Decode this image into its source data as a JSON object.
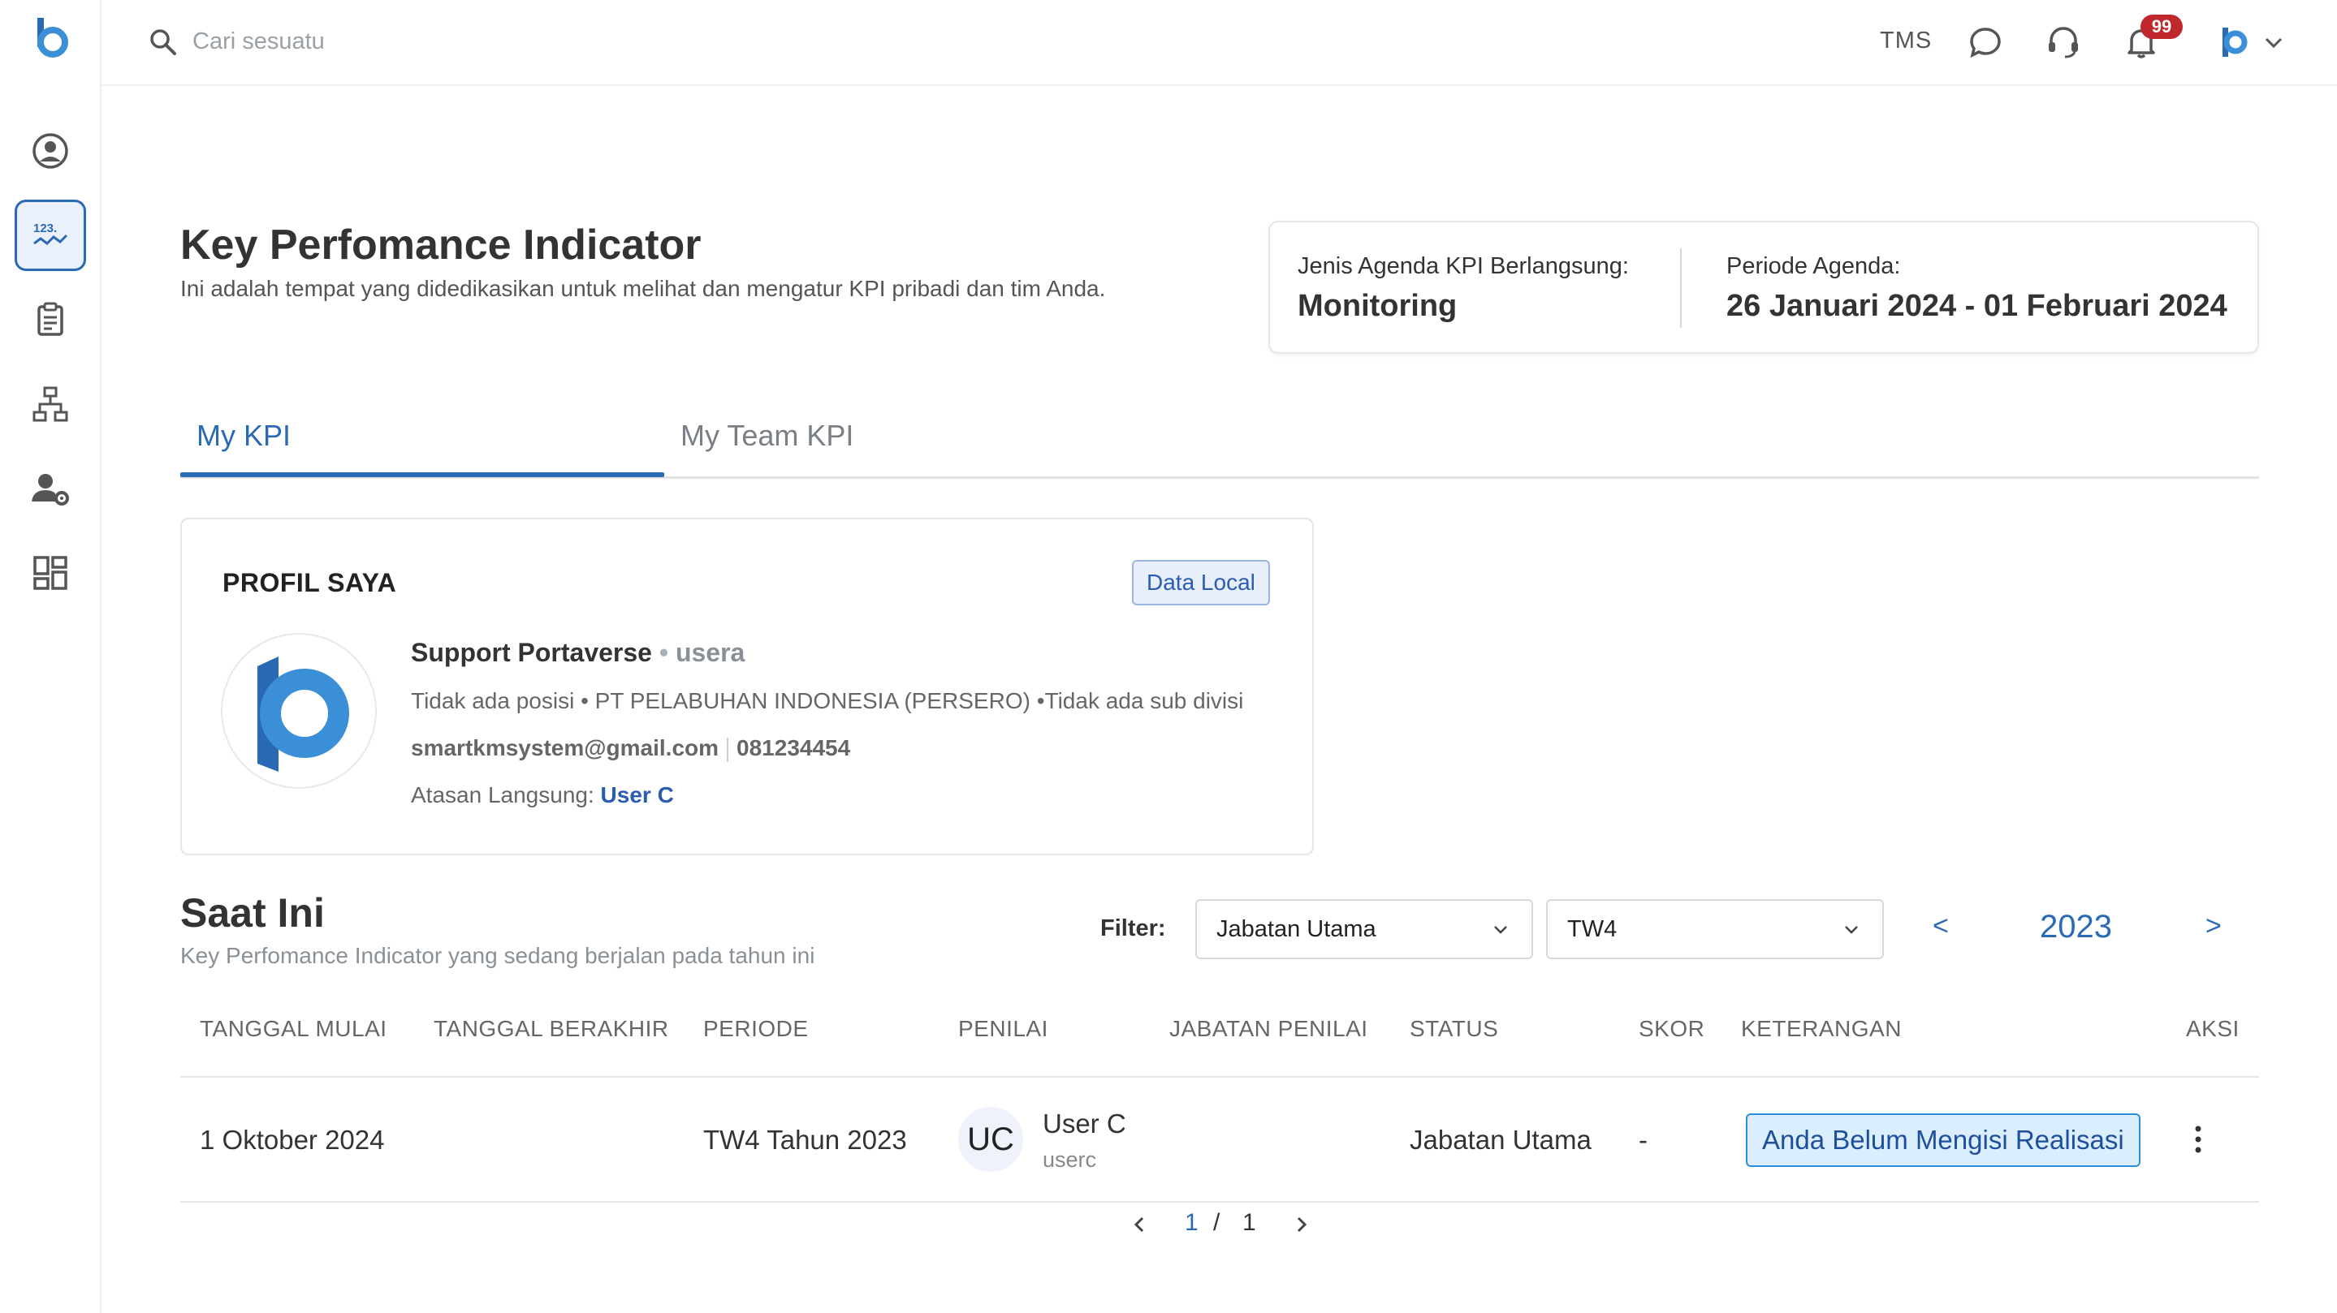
{
  "header": {
    "search_placeholder": "Cari sesuatu",
    "tms_label": "TMS",
    "notification_count": "99"
  },
  "sidebar": {
    "items": [
      {
        "name": "profile",
        "icon": "user-circle-icon"
      },
      {
        "name": "kpi",
        "icon": "kpi-chart-icon",
        "active": true
      },
      {
        "name": "clipboard",
        "icon": "clipboard-icon"
      },
      {
        "name": "org-chart",
        "icon": "org-chart-icon"
      },
      {
        "name": "user-settings",
        "icon": "user-gear-icon"
      },
      {
        "name": "dashboard",
        "icon": "dashboard-icon"
      }
    ],
    "kpi_icon_text": "123."
  },
  "page": {
    "title": "Key Perfomance Indicator",
    "subtitle": "Ini adalah tempat yang didedikasikan untuk melihat dan mengatur KPI pribadi dan tim Anda."
  },
  "agenda": {
    "type_label": "Jenis Agenda KPI Berlangsung:",
    "type_value": "Monitoring",
    "period_label": "Periode Agenda:",
    "period_value": "26 Januari 2024 - 01 Februari 2024"
  },
  "tabs": [
    {
      "label": "My KPI",
      "active": true
    },
    {
      "label": "My Team KPI",
      "active": false
    }
  ],
  "profile": {
    "section_title": "PROFIL SAYA",
    "badge": "Data Local",
    "name": "Support Portaverse",
    "dot": "•",
    "username": "usera",
    "position_line": "Tidak ada posisi • PT PELABUHAN INDONESIA (PERSERO) •Tidak ada sub divisi",
    "email": "smartkmsystem@gmail.com",
    "phone": "081234454",
    "supervisor_label": "Atasan Langsung:",
    "supervisor_name": "User C"
  },
  "current": {
    "title": "Saat Ini",
    "subtitle": "Key Perfomance Indicator yang sedang berjalan pada tahun ini",
    "filter_label": "Filter:",
    "filter_position": "Jabatan Utama",
    "filter_period": "TW4",
    "prev": "<",
    "next": ">",
    "year": "2023"
  },
  "table": {
    "headers": {
      "start": "TANGGAL MULAI",
      "end": "TANGGAL BERAKHIR",
      "period": "PERIODE",
      "reviewer": "PENILAI",
      "reviewer_position": "JABATAN PENILAI",
      "status": "STATUS",
      "score": "SKOR",
      "note": "KETERANGAN",
      "action": "AKSI"
    },
    "rows": [
      {
        "start": "1 Oktober 2024",
        "end": "",
        "period": "TW4 Tahun 2023",
        "reviewer_initials": "UC",
        "reviewer_name": "User C",
        "reviewer_username": "userc",
        "reviewer_position": "",
        "status": "Jabatan Utama",
        "score": "-",
        "note": "Anda Belum Mengisi Realisasi"
      }
    ]
  },
  "pagination": {
    "current": "1",
    "separator": "/",
    "total": "1"
  },
  "colors": {
    "accent": "#2a6ab5",
    "badge_red": "#c0282d",
    "logo_blue": "#3a8fd6"
  }
}
